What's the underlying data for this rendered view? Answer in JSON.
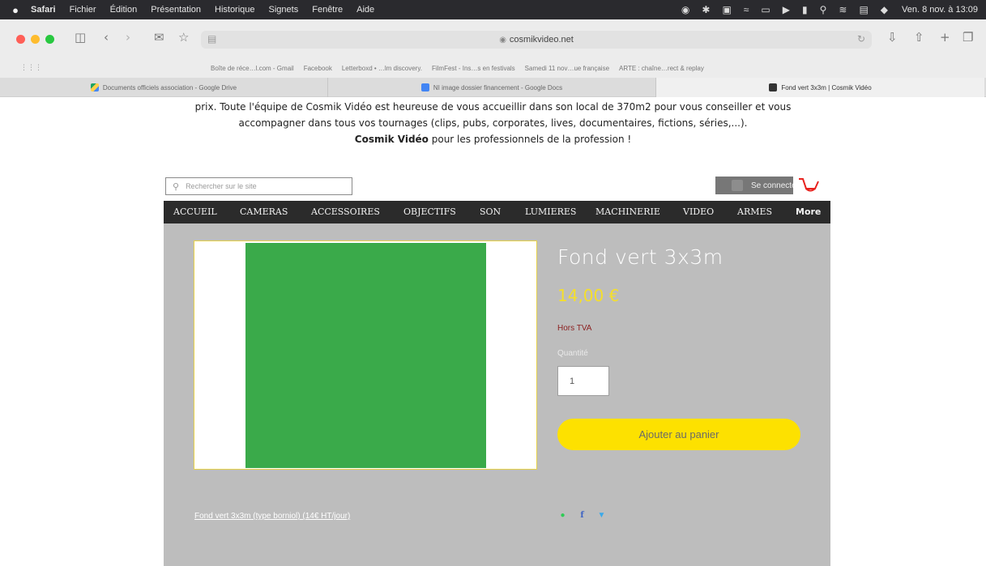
{
  "menubar": {
    "apple_icon": "apple-logo-icon",
    "items": [
      "Safari",
      "Fichier",
      "Édition",
      "Présentation",
      "Historique",
      "Signets",
      "Fenêtre",
      "Aide"
    ],
    "clock": "Ven. 8 nov. à 13:09"
  },
  "browser": {
    "url": "cosmikvideo.net",
    "favorites": [
      "Boîte de réce…l.com - Gmail",
      "Facebook",
      "Letterboxd • …lm discovery.",
      "FilmFest - Ins…s en festivals",
      "Samedi 11 nov…ue française",
      "ARTE : chaîne…rect & replay"
    ],
    "tabs": [
      {
        "title": "Documents officiels association - Google Drive",
        "favicon": "google-drive-icon"
      },
      {
        "title": "NI image dossier financement - Google Docs",
        "favicon": "google-docs-icon"
      },
      {
        "title": "Fond vert 3x3m | Cosmik Vidéo",
        "favicon": "cosmik-favicon"
      }
    ]
  },
  "intro": {
    "line1": "prix. Toute l'équipe de Cosmik Vidéo est heureuse de vous accueillir dans son local de 370m2 pour vous conseiller et vous",
    "line2": "accompagner dans tous vos tournages (clips, pubs, corporates, lives, documentaires, fictions, séries,...).",
    "brand": "Cosmik Vidéo",
    "line3_rest": " pour les professionnels de la profession !"
  },
  "header": {
    "search_placeholder": "Rechercher sur le site",
    "login_label": "Se connecter"
  },
  "nav": {
    "items": [
      "ACCUEIL",
      "CAMERAS",
      "ACCESSOIRES",
      "OBJECTIFS",
      "SON",
      "LUMIERES",
      "MACHINERIE",
      "VIDEO",
      "ARMES",
      "More"
    ]
  },
  "product": {
    "title": "Fond vert 3x3m",
    "price": "14,00 €",
    "tax_note": "Hors TVA",
    "quantity_label": "Quantité",
    "quantity_value": "1",
    "add_to_cart": "Ajouter au panier",
    "description_link": "Fond vert 3x3m (type borniol) (14€ HT/jour)",
    "colors": {
      "price": "#f5df2a",
      "button": "#fde100",
      "tax_note": "#8b1f1f",
      "background": "#bdbdbd"
    }
  }
}
